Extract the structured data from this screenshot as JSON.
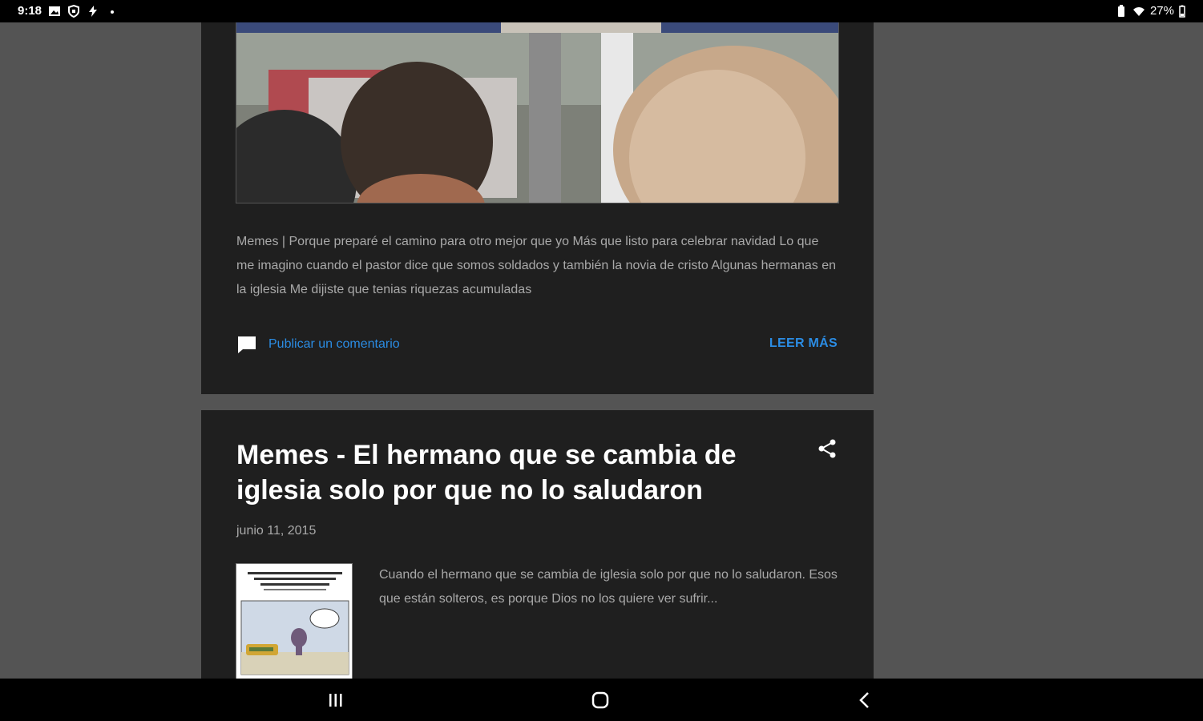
{
  "status_bar": {
    "time": "9:18",
    "battery": "27%"
  },
  "post1": {
    "snippet": " Memes | Porque preparé el camino para otro mejor que yo Más que listo para celebrar navidad Lo que me imagino cuando el pastor dice que somos soldados y también la novia de cristo Algunas hermanas en la iglesia Me dijiste que tenias riquezas acumuladas",
    "comment_label": "Publicar un comentario",
    "read_more_label": "LEER MÁS"
  },
  "post2": {
    "title": "Memes - El hermano que se cambia de iglesia solo por que no lo saludaron",
    "date": "junio 11, 2015",
    "excerpt": "Cuando el hermano que se cambia de iglesia solo por que no lo saludaron.  Esos que están solteros, es porque Dios no los quiere ver sufrir..."
  },
  "colors": {
    "background": "#545454",
    "card": "#1f1f1f",
    "link": "#2b8ce3",
    "muted_text": "#a9a9a9"
  },
  "icons": {
    "status_left": [
      "image-icon",
      "shield-icon",
      "bolt-icon",
      "dot-icon"
    ],
    "status_right": [
      "battery-saver-icon",
      "wifi-icon",
      "battery-icon"
    ],
    "nav": [
      "recents-icon",
      "home-icon",
      "back-icon"
    ]
  }
}
